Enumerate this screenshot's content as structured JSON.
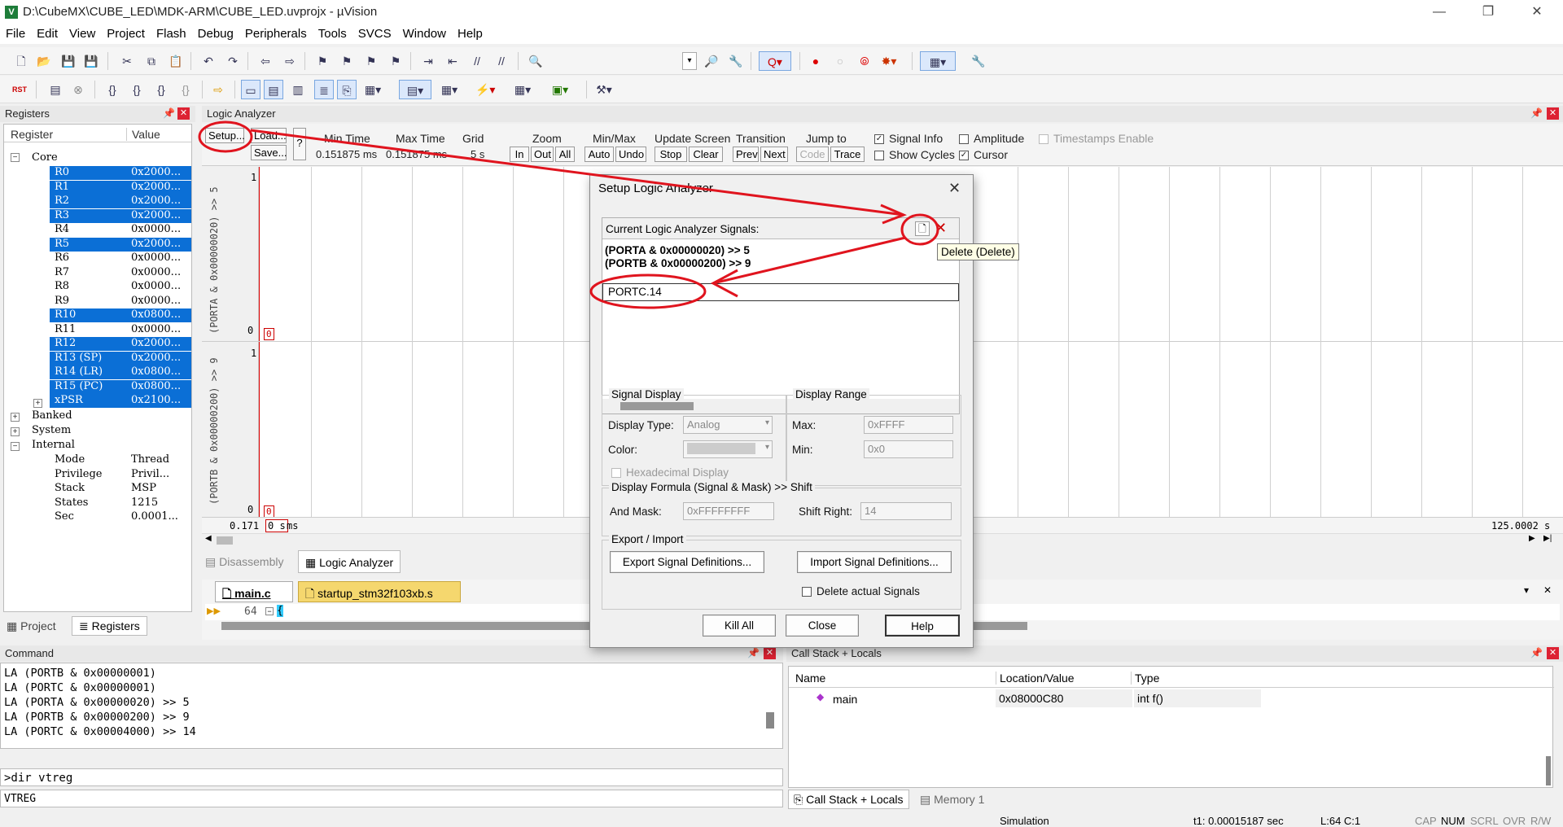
{
  "window": {
    "title": "D:\\CubeMX\\CUBE_LED\\MDK-ARM\\CUBE_LED.uvprojx - µVision",
    "controls": [
      "—",
      "❐",
      "✕"
    ]
  },
  "menu": [
    "File",
    "Edit",
    "View",
    "Project",
    "Flash",
    "Debug",
    "Peripherals",
    "Tools",
    "SVCS",
    "Window",
    "Help"
  ],
  "toolbar2_rst": "RST",
  "registers": {
    "panel_title": "Registers",
    "col_register": "Register",
    "col_value": "Value",
    "core_label": "Core",
    "core": [
      {
        "name": "R0",
        "value": "0x2000...",
        "selected": true
      },
      {
        "name": "R1",
        "value": "0x2000...",
        "selected": true
      },
      {
        "name": "R2",
        "value": "0x2000...",
        "selected": true
      },
      {
        "name": "R3",
        "value": "0x2000...",
        "selected": true
      },
      {
        "name": "R4",
        "value": "0x0000...",
        "selected": false
      },
      {
        "name": "R5",
        "value": "0x2000...",
        "selected": true
      },
      {
        "name": "R6",
        "value": "0x0000...",
        "selected": false
      },
      {
        "name": "R7",
        "value": "0x0000...",
        "selected": false
      },
      {
        "name": "R8",
        "value": "0x0000...",
        "selected": false
      },
      {
        "name": "R9",
        "value": "0x0000...",
        "selected": false
      },
      {
        "name": "R10",
        "value": "0x0800...",
        "selected": true
      },
      {
        "name": "R11",
        "value": "0x0000...",
        "selected": false
      },
      {
        "name": "R12",
        "value": "0x2000...",
        "selected": true
      },
      {
        "name": "R13 (SP)",
        "value": "0x2000...",
        "selected": true
      },
      {
        "name": "R14 (LR)",
        "value": "0x0800...",
        "selected": true
      },
      {
        "name": "R15 (PC)",
        "value": "0x0800...",
        "selected": true
      },
      {
        "name": "xPSR",
        "value": "0x2100...",
        "selected": true
      }
    ],
    "banked": "Banked",
    "system": "System",
    "internal": "Internal",
    "internal_rows": [
      {
        "name": "Mode",
        "value": "Thread"
      },
      {
        "name": "Privilege",
        "value": "Privil..."
      },
      {
        "name": "Stack",
        "value": "MSP"
      },
      {
        "name": "States",
        "value": "1215"
      },
      {
        "name": "Sec",
        "value": "0.0001..."
      }
    ],
    "tab_project": "Project",
    "tab_registers": "Registers"
  },
  "logic_analyzer": {
    "panel_title": "Logic Analyzer",
    "setup": "Setup...",
    "load": "Load...",
    "save": "Save...",
    "help": "?",
    "min_time_label": "Min Time",
    "min_time": "0.151875 ms",
    "max_time_label": "Max Time",
    "max_time": "0.151875 ms",
    "grid_label": "Grid",
    "grid": "5 s",
    "zoom_label": "Zoom",
    "zoom_in": "In",
    "zoom_out": "Out",
    "zoom_all": "All",
    "minmax_label": "Min/Max",
    "auto": "Auto",
    "undo": "Undo",
    "update_label": "Update Screen",
    "stop": "Stop",
    "clear": "Clear",
    "transition_label": "Transition",
    "prev": "Prev",
    "next": "Next",
    "jump_label": "Jump to",
    "code": "Code",
    "trace": "Trace",
    "signal_info": "Signal Info",
    "show_cycles": "Show Cycles",
    "amplitude": "Amplitude",
    "cursor": "Cursor",
    "timestamps": "Timestamps Enable",
    "sig1_label": "(PORTA & 0x00000020) >> 5",
    "sig2_label": "(PORTB & 0x00000200) >> 9",
    "one": "1",
    "zero": "0",
    "boxed_zero": "0",
    "time_left": "0.171",
    "time_box": "0 s",
    "time_unit": "ms",
    "time_right": "125.0002 s"
  },
  "tabs_mid": {
    "disassembly": "Disassembly",
    "logic_analyzer": "Logic Analyzer"
  },
  "editor": {
    "tab_main": "main.c",
    "tab_startup": "startup_stm32f103xb.s",
    "line_no": "64",
    "line_text": "{"
  },
  "dialog": {
    "title": "Setup Logic Analyzer",
    "current_signals": "Current Logic Analyzer Signals:",
    "signals": [
      "(PORTA & 0x00000020) >> 5",
      "(PORTB & 0x00000200) >> 9"
    ],
    "new_signal_value": "PORTC.14",
    "tooltip": "Delete (Delete)",
    "signal_display": "Signal Display",
    "display_type_label": "Display Type:",
    "display_type": "Analog",
    "color_label": "Color:",
    "hex_display": "Hexadecimal Display",
    "display_range": "Display Range",
    "max_label": "Max:",
    "max": "0xFFFF",
    "min_label": "Min:",
    "min": "0x0",
    "formula": "Display Formula (Signal & Mask) >> Shift",
    "and_mask_label": "And Mask:",
    "and_mask": "0xFFFFFFFF",
    "shift_right_label": "Shift Right:",
    "shift_right": "14",
    "export_import": "Export / Import",
    "export_btn": "Export Signal Definitions...",
    "import_btn": "Import Signal Definitions...",
    "delete_actual": "Delete actual Signals",
    "kill_all": "Kill All",
    "close": "Close",
    "help": "Help"
  },
  "command": {
    "panel_title": "Command",
    "lines": [
      "LA (PORTB & 0x00000001)",
      "LA (PORTC & 0x00000001)",
      "LA (PORTA & 0x00000020) >> 5",
      "LA (PORTB & 0x00000200) >> 9",
      "LA (PORTC & 0x00004000) >> 14"
    ],
    "input": ">dir vtreg",
    "output": "VTREG"
  },
  "callstack": {
    "panel_title": "Call Stack + Locals",
    "col_name": "Name",
    "col_location": "Location/Value",
    "col_type": "Type",
    "row_name": "main",
    "row_location": "0x08000C80",
    "row_type": "int f()",
    "tab_callstack": "Call Stack + Locals",
    "tab_memory": "Memory 1"
  },
  "status": {
    "simulation": "Simulation",
    "t1": "t1: 0.00015187 sec",
    "pos": "L:64 C:1",
    "cap": "CAP",
    "num": "NUM",
    "scrl": "SCRL",
    "ovr": "OVR",
    "rw": "R/W"
  },
  "colors": {
    "selection": "#0b6fd6",
    "annotation": "#e0141e",
    "tab_yellow": "#f5d76e"
  }
}
